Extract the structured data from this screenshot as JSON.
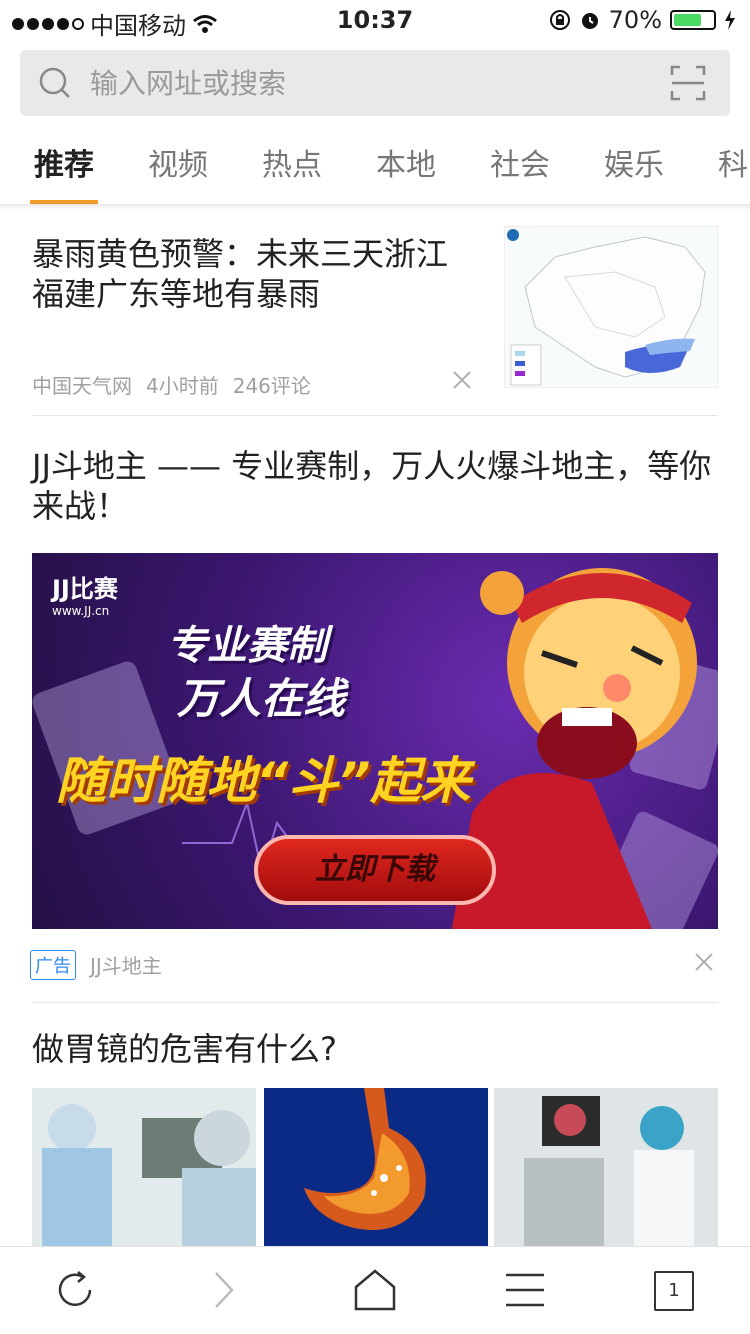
{
  "status_bar": {
    "carrier": "中国移动",
    "time": "10:37",
    "battery": "70%",
    "battery_level": 0.7
  },
  "search": {
    "placeholder": "输入网址或搜索"
  },
  "tabs": [
    "推荐",
    "视频",
    "热点",
    "本地",
    "社会",
    "娱乐",
    "科"
  ],
  "articles": [
    {
      "title": "暴雨黄色预警：未来三天浙江福建广东等地有暴雨",
      "source": "中国天气网",
      "time": "4小时前",
      "comments": "246评论"
    }
  ],
  "ad": {
    "title": "JJ斗地主 —— 专业赛制，万人火爆斗地主，等你来战！",
    "banner": {
      "logo": "JJ比赛",
      "logo_url": "www.JJ.cn",
      "line1": "专业赛制",
      "line2": "万人在线",
      "line3": "随时随地“斗”起来",
      "button": "立即下载"
    },
    "tag": "广告",
    "source": "JJ斗地主"
  },
  "article3": {
    "title": "做胃镜的危害有什么?"
  },
  "bottom_bar": {
    "tab_count": "1"
  },
  "colors": {
    "accent": "#f39a2c",
    "ad_tag": "#2d8bf0",
    "battery": "#4cd964"
  }
}
